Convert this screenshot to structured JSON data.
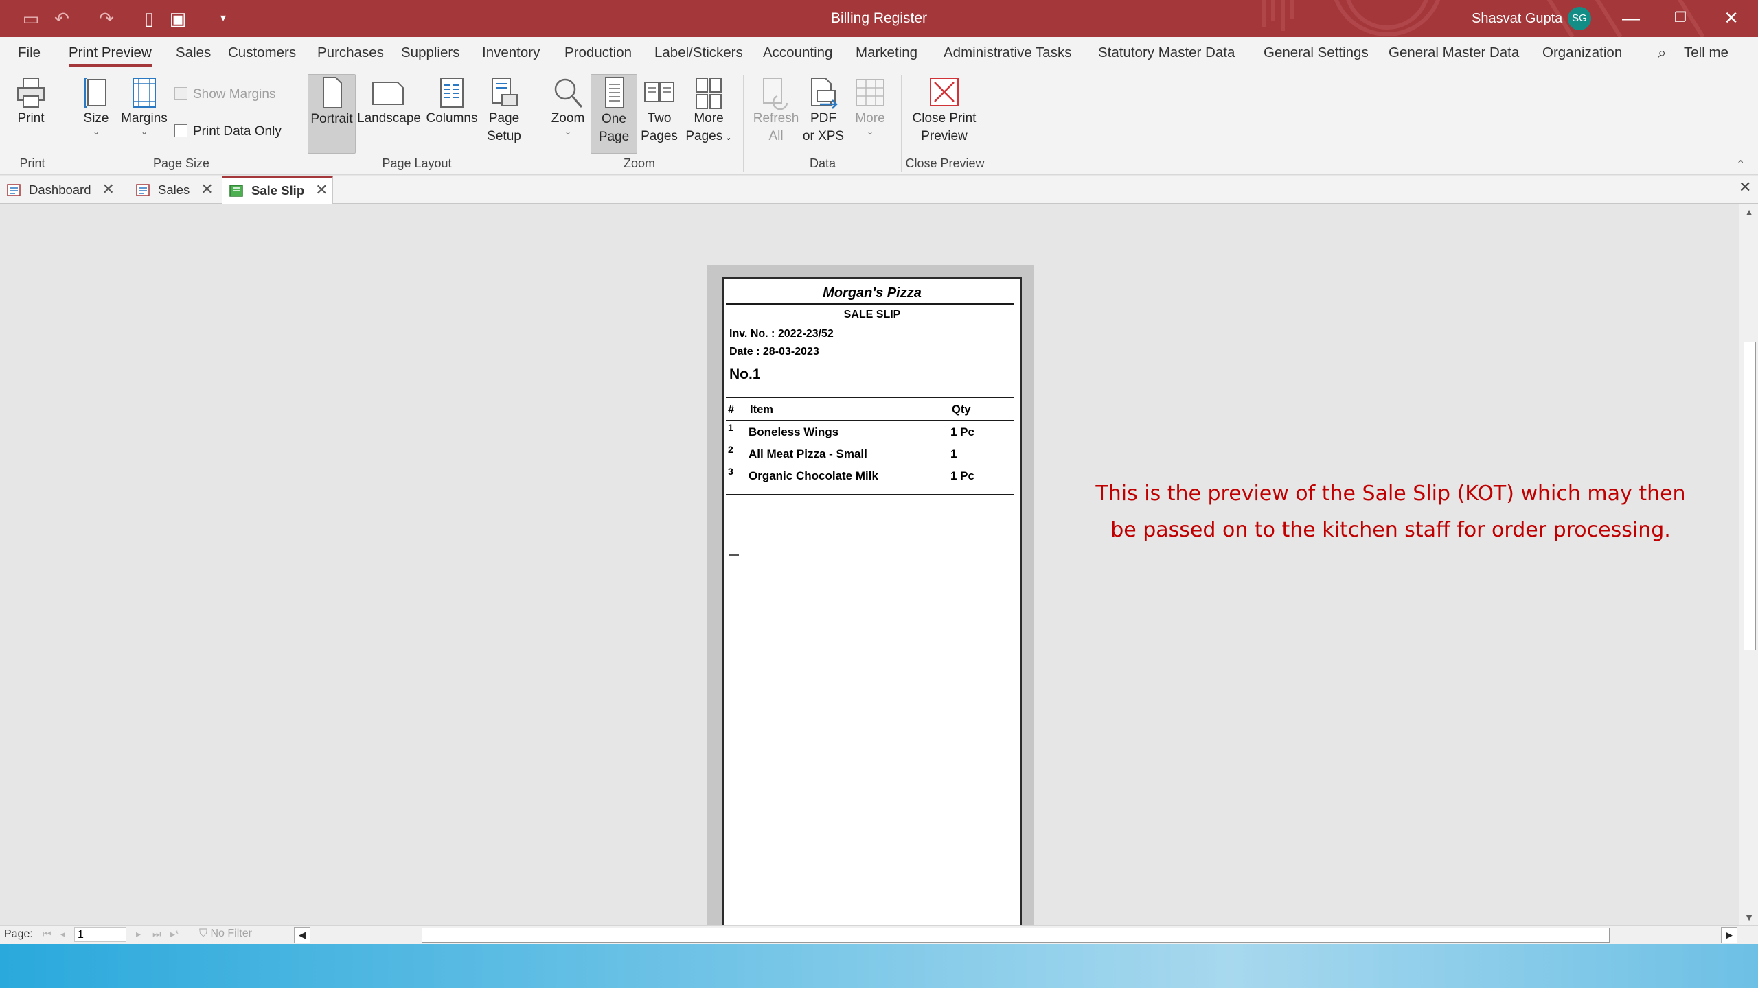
{
  "titlebar": {
    "title": "Billing Register",
    "user_name": "Shasvat Gupta",
    "user_initials": "SG",
    "accent": "#a4373a"
  },
  "ribbon_tabs": [
    "File",
    "Print Preview",
    "Sales",
    "Customers",
    "Purchases",
    "Suppliers",
    "Inventory",
    "Production",
    "Label/Stickers",
    "Accounting",
    "Marketing",
    "Administrative Tasks",
    "Statutory Master Data",
    "General Settings",
    "General Master Data",
    "Organization",
    "Tell me"
  ],
  "ribbon": {
    "print": "Print",
    "size": "Size",
    "margins": "Margins",
    "show_margins": "Show Margins",
    "print_data_only": "Print Data Only",
    "portrait": "Portrait",
    "landscape": "Landscape",
    "columns": "Columns",
    "page_setup_1": "Page",
    "page_setup_2": "Setup",
    "zoom": "Zoom",
    "one_page_1": "One",
    "one_page_2": "Page",
    "two_pages_1": "Two",
    "two_pages_2": "Pages",
    "more_pages_1": "More",
    "more_pages_2": "Pages",
    "refresh_1": "Refresh",
    "refresh_2": "All",
    "pdf_1": "PDF",
    "pdf_2": "or XPS",
    "more": "More",
    "close_1": "Close Print",
    "close_2": "Preview",
    "groups": {
      "print": "Print",
      "page_size": "Page Size",
      "page_layout": "Page Layout",
      "zoom": "Zoom",
      "data": "Data",
      "close_preview": "Close Preview"
    }
  },
  "doc_tabs": [
    "Dashboard",
    "Sales",
    "Sale Slip"
  ],
  "slip": {
    "shop": "Morgan's Pizza",
    "title": "SALE SLIP",
    "inv_no": "Inv. No. : 2022-23/52",
    "date": "Date :  28-03-2023",
    "token": "No.1",
    "headers": {
      "num": "#",
      "item": "Item",
      "qty": "Qty"
    },
    "rows": [
      {
        "n": "1",
        "item": "Boneless Wings",
        "qty": "1 Pc"
      },
      {
        "n": "2",
        "item": "All Meat Pizza - Small",
        "qty": "1"
      },
      {
        "n": "3",
        "item": "Organic Chocolate Milk",
        "qty": "1 Pc"
      }
    ]
  },
  "note": {
    "line1": "This is the preview of the Sale Slip (KOT) which may then",
    "line2": "be passed on to the kitchen staff for order processing."
  },
  "navbar": {
    "page_label": "Page:",
    "page_value": "1",
    "filter": "No Filter"
  }
}
